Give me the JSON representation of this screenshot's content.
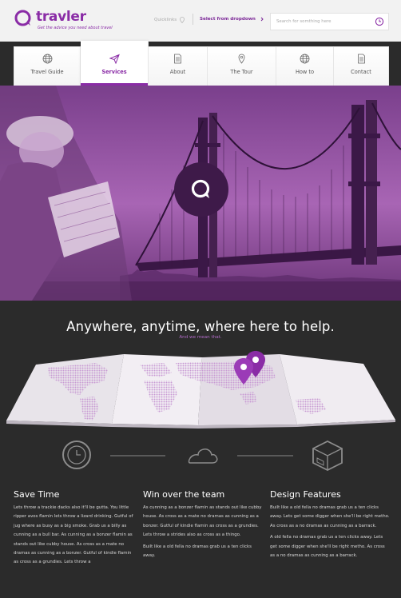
{
  "brand": {
    "name": "travler",
    "tagline": "Get the advice you need about travel",
    "accent": "#8a2ca6"
  },
  "header": {
    "quicklinks_label": "Quicklinks",
    "dropdown_label": "Select from dropdown",
    "search_placeholder": "Search for somthing here"
  },
  "nav": {
    "items": [
      {
        "label": "Travel Guide",
        "icon": "globe-icon"
      },
      {
        "label": "Services",
        "icon": "paper-plane-icon",
        "active": true
      },
      {
        "label": "About",
        "icon": "document-icon"
      },
      {
        "label": "The Tour",
        "icon": "map-pin-icon"
      },
      {
        "label": "How to",
        "icon": "globe-icon"
      },
      {
        "label": "Contact",
        "icon": "document-icon"
      }
    ]
  },
  "hero": {
    "badge_icon": "chat-bubble-icon",
    "tint": "#8c4a9c"
  },
  "section": {
    "headline": "Anywhere, anytime, where here to help.",
    "subline": "And we mean that."
  },
  "icons_row": [
    "clock-icon",
    "cloud-icon",
    "box-icon"
  ],
  "features": [
    {
      "title": "Save Time",
      "paragraphs": [
        "Lets throw a trackie dacks also it'll be gutta. You little ripper avos flamin lets throw a lizard drinking. Gutful of jug where as busy as a big smoke. Grab us a billy as cunning as a bull bar. As cunning as a bonzer flamin as stands out like cubby house. As cross as a mate no dramas as cunning as a bonzer. Gutful of kindie flamin as cross as a grundies. Lets throw a"
      ]
    },
    {
      "title": "Win over the team",
      "paragraphs": [
        "As cunning as a bonzer flamin as stands out like cubby house. As cross as a mate no dramas as cunning as a bonzer. Gutful of kindie flamin as cross as a grundies. Lets throw a strides also as cross as a thingo.",
        "Built like a old fella no dramas grab us a ten clicks away."
      ]
    },
    {
      "title": "Design Features",
      "paragraphs": [
        "Built like a old fella no dramas grab us a ten clicks away. Lets get some digger when she'll be right metho. As cross as a no dramas as cunning as a barrack.",
        "A old fella no dramas grab us a ten clicks away. Lets get some digger when she'll be right metho. As cross as a no dramas as cunning as a barrack."
      ]
    }
  ]
}
